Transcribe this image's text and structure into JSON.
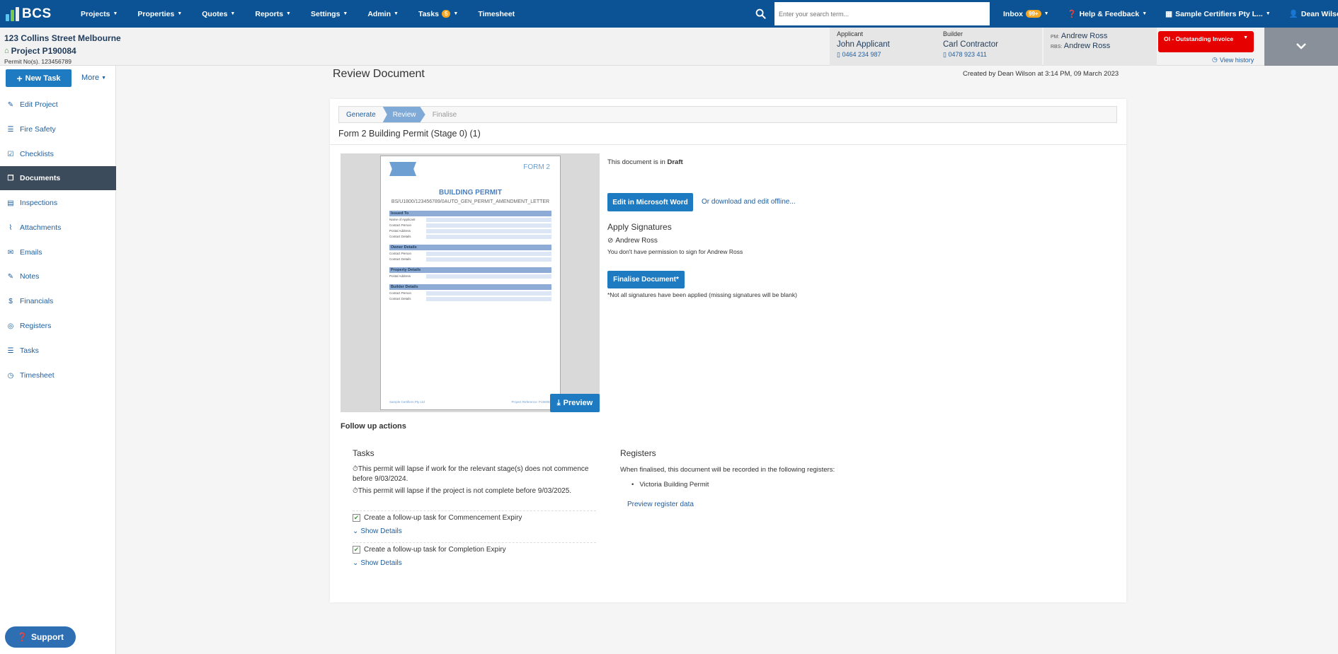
{
  "nav": {
    "brand": "BCS",
    "items": [
      {
        "label": "Projects"
      },
      {
        "label": "Properties"
      },
      {
        "label": "Quotes"
      },
      {
        "label": "Reports"
      },
      {
        "label": "Settings"
      },
      {
        "label": "Admin"
      },
      {
        "label": "Tasks",
        "badge": "5"
      },
      {
        "label": "Timesheet"
      }
    ],
    "search_placeholder": "Enter your search term...",
    "inbox_label": "Inbox",
    "inbox_badge": "99+",
    "help_label": "Help & Feedback",
    "company_label": "Sample Certifiers Pty L...",
    "user_label": "Dean Wilson"
  },
  "project": {
    "address": "123 Collins Street Melbourne",
    "number": "Project P190084",
    "permit": "Permit No(s). 123456789",
    "applicant_label": "Applicant",
    "applicant_name": "John Applicant",
    "applicant_phone": "0464 234 987",
    "builder_label": "Builder",
    "builder_name": "Carl Contractor",
    "builder_phone": "0478 923 411",
    "pm_prefix": "PM:",
    "pm_name": "Andrew Ross",
    "rbs_prefix": "RBS:",
    "rbs_name": "Andrew Ross",
    "status_label": "OI - Outstanding Invoice",
    "view_history": "View history"
  },
  "sidebar": {
    "new_task": "New Task",
    "more": "More",
    "items": [
      {
        "label": "Edit Project",
        "icon": "pencil-icon"
      },
      {
        "label": "Fire Safety",
        "icon": "list-icon"
      },
      {
        "label": "Checklists",
        "icon": "checkbox-icon"
      },
      {
        "label": "Documents",
        "icon": "documents-icon"
      },
      {
        "label": "Inspections",
        "icon": "file-icon"
      },
      {
        "label": "Attachments",
        "icon": "paperclip-icon"
      },
      {
        "label": "Emails",
        "icon": "envelope-icon"
      },
      {
        "label": "Notes",
        "icon": "note-icon"
      },
      {
        "label": "Financials",
        "icon": "dollar-icon"
      },
      {
        "label": "Registers",
        "icon": "target-icon"
      },
      {
        "label": "Tasks",
        "icon": "tasks-icon"
      },
      {
        "label": "Timesheet",
        "icon": "stopwatch-icon"
      }
    ],
    "active": "Documents",
    "support": "Support"
  },
  "page": {
    "title": "Review Document",
    "created_by": "Created by Dean Wilson at 3:14 PM, 09 March 2023",
    "steps": [
      "Generate",
      "Review",
      "Finalise"
    ],
    "form_title": "Form 2 Building Permit (Stage 0) (1)",
    "status_prefix": "This document is in",
    "status_value": "Draft",
    "edit_word": "Edit in Microsoft Word",
    "download_link": "Or download and edit offline...",
    "apply_signatures": "Apply Signatures",
    "signer": "Andrew Ross",
    "no_permission": "You don't have permission to sign for Andrew Ross",
    "finalise_button": "Finalise Document*",
    "finalise_note": "*Not all signatures have been applied (missing signatures will be blank)",
    "preview_button": "Preview",
    "followup_title": "Follow up actions",
    "tasks_title": "Tasks",
    "task_notes": [
      "This permit will lapse if work for the relevant stage(s) does not commence before 9/03/2024.",
      "This permit will lapse if the project is not complete before 9/03/2025."
    ],
    "task_checks": [
      "Create a follow-up task for Commencement Expiry",
      "Create a follow-up task for Completion Expiry"
    ],
    "show_details": "Show Details",
    "registers_title": "Registers",
    "registers_text": "When finalised, this document will be recorded in the following registers:",
    "registers_items": [
      "Victoria Building Permit"
    ],
    "preview_register": "Preview register data"
  },
  "doc_preview": {
    "form_label": "FORM 2",
    "title": "BUILDING PERMIT",
    "subtitle": "BS/U1800/123456789/0AUTO_GEN_PERMIT_AMENDMENT_LETTER",
    "sections": [
      "Issued To",
      "Owner Details",
      "Property Details",
      "Builder Details"
    ],
    "fields": [
      "Name of Applicant",
      "Contact Person",
      "Postal Address",
      "Contact Details"
    ],
    "footer_left": "Sample Certifiers Pty Ltd",
    "footer_right": "Project Reference: P190084"
  },
  "colors": {
    "nav_bg": "#0b5394",
    "accent": "#1f7bc1",
    "status_red": "#e60000",
    "sidebar_active": "#3c4b5c"
  }
}
